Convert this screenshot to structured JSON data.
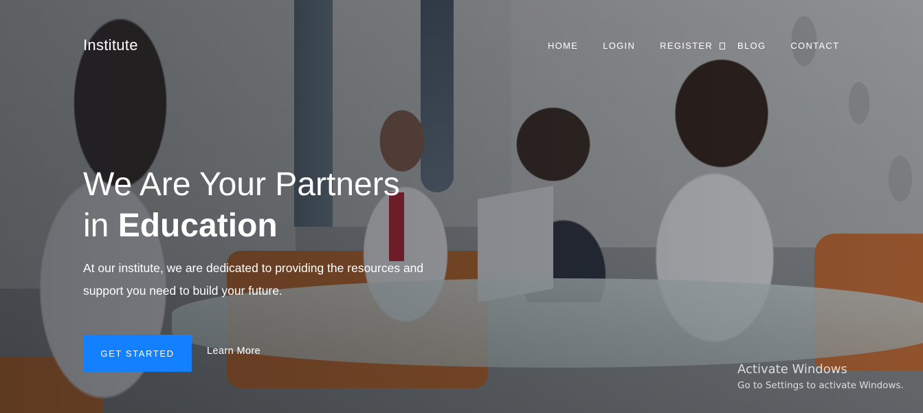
{
  "brand": {
    "logo_text": "Institute"
  },
  "nav": {
    "items": [
      {
        "label": "HOME"
      },
      {
        "label": "LOGIN"
      },
      {
        "label": "REGISTER"
      },
      {
        "label": "BLOG"
      },
      {
        "label": "CONTACT"
      }
    ]
  },
  "hero": {
    "headline_line1": "We Are Your Partners",
    "headline_line2_prefix": "in ",
    "headline_line2_bold": "Education",
    "description": "At our institute, we are dedicated to providing the resources and support you need to build your future.",
    "primary_button_label": "GET STARTED",
    "secondary_link_label": "Learn More"
  },
  "watermark": {
    "title": "Activate Windows",
    "subtitle": "Go to Settings to activate Windows."
  },
  "colors": {
    "primary_button": "#1380ff",
    "text": "#ffffff"
  }
}
